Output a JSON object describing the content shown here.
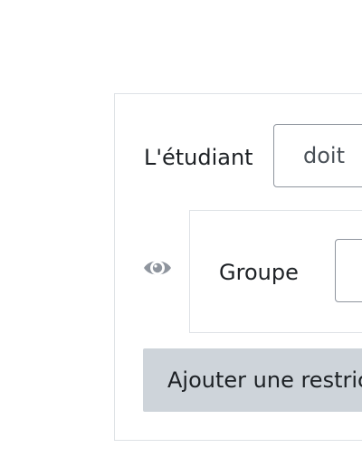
{
  "restriction": {
    "student_label": "L'étudiant",
    "must_select": {
      "value": "doit"
    },
    "eye_icon": "eye-icon",
    "condition": {
      "type_label": "Groupe"
    },
    "add_restriction_label": "Ajouter une restriction"
  },
  "colors": {
    "border": "#dee2e6",
    "input_border": "#8f959e",
    "button_bg": "#ced4da",
    "icon": "#8f959e"
  }
}
